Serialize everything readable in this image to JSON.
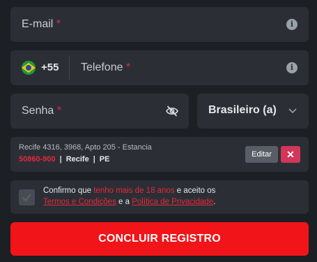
{
  "email": {
    "placeholder": "E-mail",
    "required_mark": "*"
  },
  "phone": {
    "dial_code": "+55",
    "placeholder": "Telefone",
    "required_mark": "*"
  },
  "password": {
    "placeholder": "Senha",
    "required_mark": "*"
  },
  "gender": {
    "selected": "Brasileiro (a)"
  },
  "address": {
    "line1": "Recife 4316, 3968, Apto 205 - Estancia",
    "cep": "50860-900",
    "city": "Recife",
    "state": "PE",
    "separator": "|",
    "edit_label": "Editar",
    "delete_label": "✕"
  },
  "terms": {
    "prefix": "Confirmo que ",
    "age_text": "tenho mais de 18 anos",
    "middle": " e aceito os ",
    "terms_link": "Termos e Condições",
    "conj": " e a ",
    "privacy_link": "Política de Privacidade",
    "suffix": "."
  },
  "submit": {
    "label": "CONCLUIR REGISTRO"
  },
  "colors": {
    "accent": "#f11418",
    "background": "#1c1f24",
    "field": "#2b2f35",
    "delete": "#d2365b"
  }
}
